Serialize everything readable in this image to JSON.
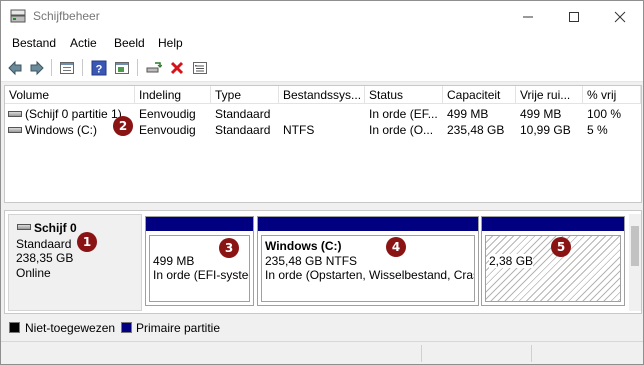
{
  "window": {
    "title": "Schijfbeheer",
    "app_icon": "disk-management-icon",
    "controls": [
      "minimize-icon",
      "maximize-icon",
      "close-icon"
    ]
  },
  "menu": {
    "items": [
      "Bestand",
      "Actie",
      "Beeld",
      "Help"
    ]
  },
  "toolbar": {
    "buttons": [
      "back-arrow-icon",
      "forward-arrow-icon",
      "properties-list-icon",
      "help-icon",
      "action-pane-icon",
      "connect-disk-icon",
      "delete-icon",
      "settings-list-icon"
    ]
  },
  "volume_table": {
    "columns": [
      "Volume",
      "Indeling",
      "Type",
      "Bestandssys...",
      "Status",
      "Capaciteit",
      "Vrije rui...",
      "% vrij"
    ],
    "rows": [
      {
        "volume": "(Schijf 0 partitie 1)",
        "indeling": "Eenvoudig",
        "type": "Standaard",
        "fs": "",
        "status": "In orde (EF...",
        "capaciteit": "499 MB",
        "vrij": "499 MB",
        "pct": "100 %"
      },
      {
        "volume": "Windows (C:)",
        "indeling": "Eenvoudig",
        "type": "Standaard",
        "fs": "NTFS",
        "status": "In orde (O...",
        "capaciteit": "235,48 GB",
        "vrij": "10,99 GB",
        "pct": "5 %"
      }
    ]
  },
  "disk": {
    "name": "Schijf 0",
    "type": "Standaard",
    "size": "238,35 GB",
    "state": "Online",
    "partitions": [
      {
        "title": "",
        "size": "499 MB",
        "status": "In orde (EFI-systee"
      },
      {
        "title": "Windows  (C:)",
        "size": "235,48 GB NTFS",
        "status": "In orde (Opstarten, Wisselbestand, Crasl"
      },
      {
        "title": "",
        "size": "2,38 GB",
        "status": ""
      }
    ]
  },
  "legend": {
    "unallocated": "Niet-toegewezen",
    "primary": "Primaire partitie",
    "unallocated_color": "#000000",
    "primary_color": "#000080"
  },
  "callouts": [
    "1",
    "2",
    "3",
    "4",
    "5"
  ],
  "colors": {
    "callout": "#8a1414",
    "partition_bar": "#000080"
  }
}
